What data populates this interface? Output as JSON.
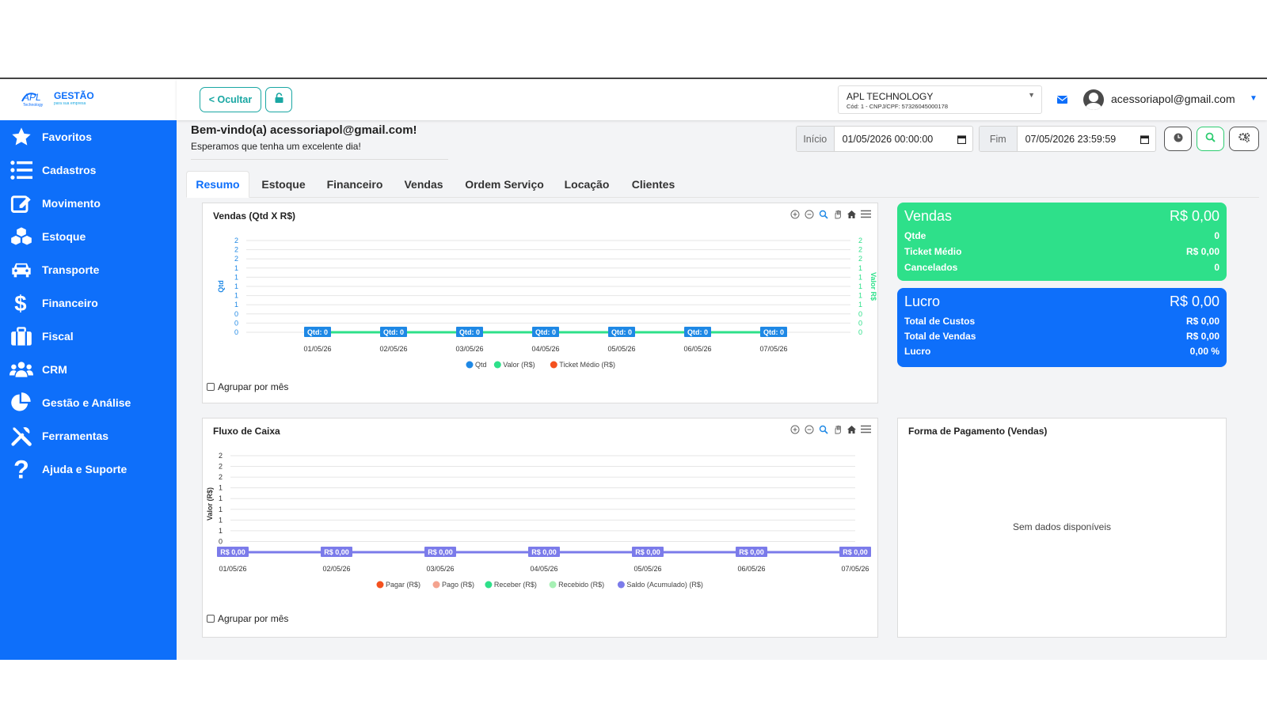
{
  "brand": {
    "logo_text": "APL",
    "logo_sub": "Technology",
    "logo_word": "GESTÃO",
    "logo_tag": "para sua empresa"
  },
  "sidebar": {
    "items": [
      {
        "label": "Favoritos",
        "icon": "star-icon"
      },
      {
        "label": "Cadastros",
        "icon": "list-icon"
      },
      {
        "label": "Movimento",
        "icon": "edit-icon"
      },
      {
        "label": "Estoque",
        "icon": "boxes-icon"
      },
      {
        "label": "Transporte",
        "icon": "car-icon"
      },
      {
        "label": "Financeiro",
        "icon": "dollar-icon"
      },
      {
        "label": "Fiscal",
        "icon": "briefcase-icon"
      },
      {
        "label": "CRM",
        "icon": "users-icon"
      },
      {
        "label": "Gestão e Análise",
        "icon": "pie-chart-icon"
      },
      {
        "label": "Ferramentas",
        "icon": "tools-icon"
      },
      {
        "label": "Ajuda e Suporte",
        "icon": "question-icon"
      }
    ]
  },
  "topbar": {
    "hide_label": "< Ocultar",
    "company_name": "APL TECHNOLOGY",
    "company_sub": "Cód: 1 - CNPJ/CPF: 57326045000178",
    "user_email": "acessoriapol@gmail.com"
  },
  "welcome": {
    "title": "Bem-vindo(a) acessoriapol@gmail.com!",
    "subtitle": "Esperamos que tenha um excelente dia!"
  },
  "filters": {
    "start_label": "Início",
    "start_value": "01/05/2026 00:00:00",
    "end_label": "Fim",
    "end_value": "07/05/2026 23:59:59"
  },
  "tabs": [
    {
      "label": "Resumo",
      "active": true
    },
    {
      "label": "Estoque"
    },
    {
      "label": "Financeiro"
    },
    {
      "label": "Vendas"
    },
    {
      "label": "Ordem Serviço"
    },
    {
      "label": "Locação"
    },
    {
      "label": "Clientes"
    }
  ],
  "group_by_month_label": "Agrupar por mês",
  "kpi_vendas": {
    "title": "Vendas",
    "value": "R$ 0,00",
    "color": "#2ee08a",
    "rows": [
      {
        "label": "Qtde",
        "value": "0"
      },
      {
        "label": "Ticket Médio",
        "value": "R$ 0,00"
      },
      {
        "label": "Cancelados",
        "value": "0"
      }
    ]
  },
  "kpi_lucro": {
    "title": "Lucro",
    "value": "R$ 0,00",
    "color": "#0e6ffa",
    "rows": [
      {
        "label": "Total de Custos",
        "value": "R$ 0,00"
      },
      {
        "label": "Total de Vendas",
        "value": "R$ 0,00"
      },
      {
        "label": "Lucro",
        "value": "0,00 %"
      }
    ]
  },
  "payment_card": {
    "title": "Forma de Pagamento (Vendas)",
    "empty_text": "Sem dados disponíveis"
  },
  "chart_data": [
    {
      "type": "line",
      "title": "Vendas (Qtd X R$)",
      "x": [
        "01/05/26",
        "02/05/26",
        "03/05/26",
        "04/05/26",
        "05/05/26",
        "06/05/26",
        "07/05/26"
      ],
      "ylabel": "Qtd",
      "y2label": "Valor R$",
      "y_ticks": [
        "0",
        "0",
        "0",
        "1",
        "1",
        "1",
        "1",
        "1",
        "2",
        "2",
        "2"
      ],
      "series": [
        {
          "name": "Qtd",
          "values": [
            0,
            0,
            0,
            0,
            0,
            0,
            0
          ],
          "color": "#1e88e5"
        },
        {
          "name": "Valor (R$)",
          "values": [
            0,
            0,
            0,
            0,
            0,
            0,
            0
          ],
          "color": "#2ee08a"
        },
        {
          "name": "Ticket Médio (R$)",
          "values": [
            0,
            0,
            0,
            0,
            0,
            0,
            0
          ],
          "color": "#f4511e"
        }
      ],
      "data_labels": [
        "Qtd: 0",
        "Qtd: 0",
        "Qtd: 0",
        "Qtd: 0",
        "Qtd: 0",
        "Qtd: 0",
        "Qtd: 0"
      ],
      "ylim": [
        0,
        2
      ],
      "legend": "bottom",
      "grid": true
    },
    {
      "type": "line",
      "title": "Fluxo de Caixa",
      "x": [
        "01/05/26",
        "02/05/26",
        "03/05/26",
        "04/05/26",
        "05/05/26",
        "06/05/26",
        "07/05/26"
      ],
      "ylabel": "Valor (R$)",
      "y_ticks": [
        "0",
        "0",
        "1",
        "1",
        "1",
        "1",
        "1",
        "2",
        "2",
        "2"
      ],
      "series": [
        {
          "name": "Pagar (R$)",
          "values": [
            0,
            0,
            0,
            0,
            0,
            0,
            0
          ],
          "color": "#f4511e"
        },
        {
          "name": "Pago (R$)",
          "values": [
            0,
            0,
            0,
            0,
            0,
            0,
            0
          ],
          "color": "#f4a38f"
        },
        {
          "name": "Receber (R$)",
          "values": [
            0,
            0,
            0,
            0,
            0,
            0,
            0
          ],
          "color": "#2ee08a"
        },
        {
          "name": "Recebido (R$)",
          "values": [
            0,
            0,
            0,
            0,
            0,
            0,
            0
          ],
          "color": "#a6f0b4"
        },
        {
          "name": "Saldo (Acumulado) (R$)",
          "values": [
            0,
            0,
            0,
            0,
            0,
            0,
            0
          ],
          "color": "#7b7bea"
        }
      ],
      "data_labels": [
        "R$ 0,00",
        "R$ 0,00",
        "R$ 0,00",
        "R$ 0,00",
        "R$ 0,00",
        "R$ 0,00",
        "R$ 0,00"
      ],
      "ylim": [
        0,
        2
      ],
      "legend": "bottom",
      "grid": true
    }
  ]
}
